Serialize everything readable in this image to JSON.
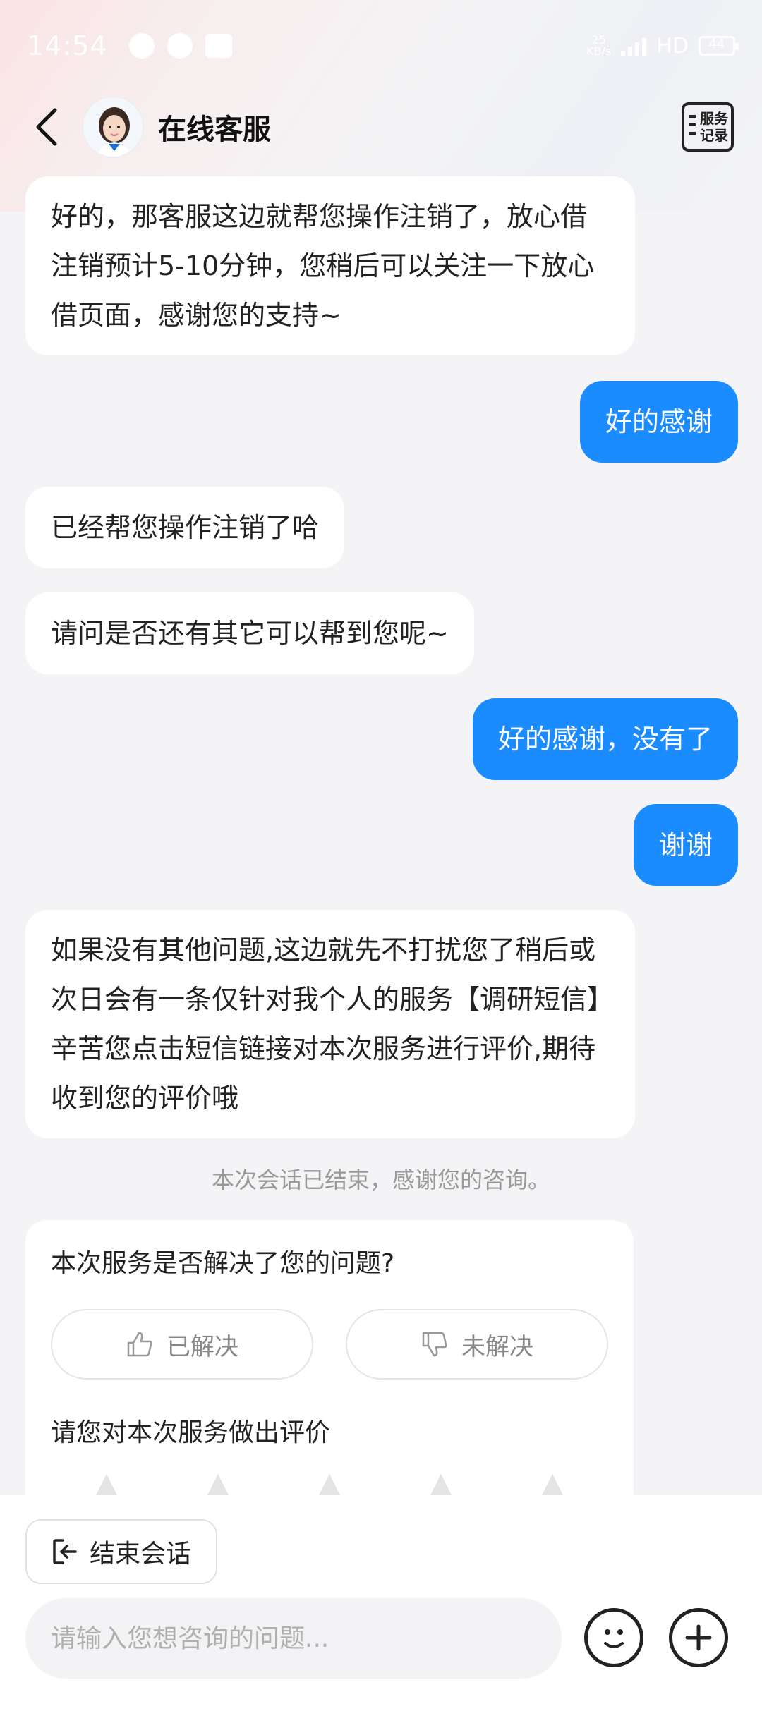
{
  "status_bar": {
    "time": "14:54",
    "network_speed": "25\nKB/s",
    "hd_label": "HD",
    "battery": "44"
  },
  "header": {
    "title": "在线客服",
    "service_record_line1": "服务",
    "service_record_line2": "记录"
  },
  "messages": [
    {
      "side": "left",
      "text": "好的，那客服这边就帮您操作注销了，放心借注销预计5-10分钟，您稍后可以关注一下放心借页面，感谢您的支持~"
    },
    {
      "side": "right",
      "text": "好的感谢"
    },
    {
      "side": "left",
      "text": "已经帮您操作注销了哈"
    },
    {
      "side": "left",
      "text": "请问是否还有其它可以帮到您呢~"
    },
    {
      "side": "right",
      "text": "好的感谢，没有了"
    },
    {
      "side": "right",
      "text": "谢谢"
    },
    {
      "side": "left",
      "text": "如果没有其他问题,这边就先不打扰您了稍后或次日会有一条仅针对我个人的服务【调研短信】辛苦您点击短信链接对本次服务进行评价,期待收到您的评价哦"
    }
  ],
  "system_note": "本次会话已结束，感谢您的咨询。",
  "survey": {
    "question": "本次服务是否解决了您的问题?",
    "resolved_label": "已解决",
    "unresolved_label": "未解决",
    "rate_prompt": "请您对本次服务做出评价"
  },
  "bottom": {
    "end_session_label": "结束会话",
    "input_placeholder": "请输入您想咨询的问题..."
  },
  "colors": {
    "accent": "#1a8cff",
    "background": "#f4f4f6"
  }
}
